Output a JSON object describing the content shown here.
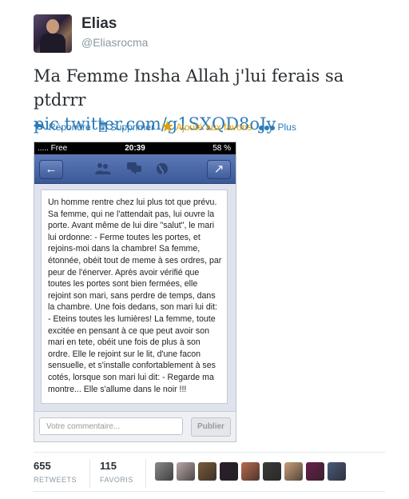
{
  "user": {
    "name": "Elias",
    "handle": "@Eliasrocma"
  },
  "tweet": {
    "text": "Ma Femme Insha Allah j'lui ferais sa ptdrrr",
    "link": "pic.twitter.com/g1SXQD8oJy"
  },
  "actions": [
    {
      "label": "Répondre",
      "icon": "reply-icon"
    },
    {
      "label": "Supprimer",
      "icon": "trash-icon"
    },
    {
      "label": "Ajouté aux favoris",
      "icon": "star-icon"
    },
    {
      "label": "Plus",
      "icon": "more-icon"
    }
  ],
  "phone": {
    "carrier": "..... Free",
    "time": "20:39",
    "battery": "58 %",
    "post_text": "Un homme rentre chez lui plus tot que prévu. Sa femme, qui ne l'attendait pas, lui ouvre la porte. Avant même de lui dire \"salut\", le mari lui ordonne: - Ferme toutes les portes, et rejoins-moi dans la chambre! Sa femme, étonnée, obéit tout de meme à ses ordres, par peur de l'énerver. Après avoir vérifié que toutes les portes sont bien fermées, elle rejoint son mari, sans perdre de temps, dans la chambre. Une fois dedans, son mari lui dit: - Eteins toutes les lumières! La femme, toute excitée en pensant à ce que peut avoir son mari en tete, obéit une fois de plus à son ordre. Elle le rejoint sur le lit, d'une facon sensuelle, et s'installe confortablement à ses cotés, lorsque son mari lui dit: - Regarde ma montre... Elle s'allume dans le noir !!!",
    "comment_placeholder": "Votre commentaire...",
    "publish_label": "Publier"
  },
  "stats": {
    "retweets": {
      "count": "655",
      "label": "RETWEETS"
    },
    "favorites": {
      "count": "115",
      "label": "FAVORIS"
    }
  },
  "colors": {
    "link": "#2b7bb9",
    "facebook": "#3b5998",
    "favorite": "#e0a100"
  },
  "favoriter_avatars": [
    {
      "color": "#8a8a8a"
    },
    {
      "color": "#b9a7a7"
    },
    {
      "color": "#7a5a3a"
    },
    {
      "color": "#2a1f2a"
    },
    {
      "color": "#b86a4e"
    },
    {
      "color": "#3a3a3a"
    },
    {
      "color": "#c9a07a"
    },
    {
      "color": "#6a1f4a"
    },
    {
      "color": "#4a5a7a"
    }
  ]
}
